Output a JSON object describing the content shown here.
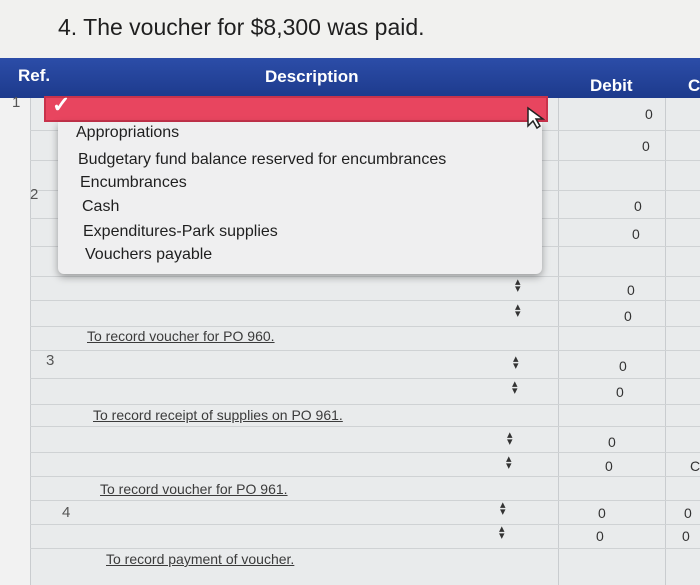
{
  "question": "4. The voucher for $8,300 was paid.",
  "header": {
    "ref": "Ref.",
    "description": "Description",
    "debit": "Debit",
    "credit": "C"
  },
  "rows": {
    "ref1": "1",
    "ref2": "2",
    "ref3": "3",
    "ref4": "4"
  },
  "dropdown": {
    "selected_mark": "✓",
    "options": [
      "Appropriations",
      "Budgetary fund balance reserved for encumbrances",
      "Encumbrances",
      "Cash",
      "Expenditures-Park supplies",
      "Vouchers payable"
    ]
  },
  "zero_value": "0",
  "memos": [
    "To record voucher for PO 960.",
    "To record receipt of supplies on PO 961.",
    "To record voucher for PO 961.",
    "To record payment of voucher."
  ],
  "icons": {
    "cursor": "mouse-pointer-icon",
    "stepper": "up-down-arrow-icon",
    "check": "check-icon"
  }
}
